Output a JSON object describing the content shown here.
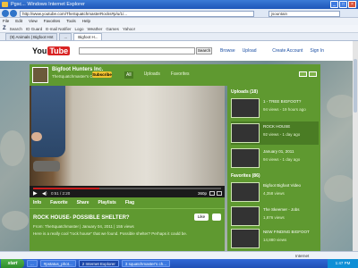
{
  "window": {
    "title": "Pgsc... Windows Internet Explorer",
    "url": "http://www.youtube.com/TheSquatchmasterRocks#p/u/1/...",
    "search_value": "jsountain",
    "buttons": [
      "minimize",
      "maximize",
      "close"
    ]
  },
  "menu": {
    "items": [
      "File",
      "Edit",
      "View",
      "Favorites",
      "Tools",
      "Help"
    ]
  },
  "toolbar": {
    "logo": "Z",
    "items": [
      "Search",
      "ID Guard",
      "E-mail Notifier",
      "Logo",
      "Weather",
      "Games",
      "Yahoo!"
    ]
  },
  "tabs": [
    {
      "label": "(9) Animals | Bigfoot Hnt",
      "active": false
    },
    {
      "label": "...",
      "active": false
    },
    {
      "label": "Bigfoot H...",
      "active": true
    }
  ],
  "youtube": {
    "logo_you": "You",
    "logo_tube": "Tube",
    "search_button": "Search",
    "links": [
      "Browse",
      "Upload"
    ],
    "right_links": [
      "Create Account",
      "Sign In"
    ]
  },
  "channel": {
    "name": "Bigfoot Hunters Inc.",
    "subtitle": "TheSquatchmaster's Channel",
    "subscribe": "Subscribe",
    "tabs": [
      "All",
      "Uploads",
      "Favorites"
    ]
  },
  "player": {
    "progress": 0.35,
    "time": "0:51 / 2:20",
    "quality": "360p"
  },
  "actions": [
    "Info",
    "Favorite",
    "Share",
    "Playlists",
    "Flag"
  ],
  "video": {
    "title": "ROCK HOUSE- POSSIBLE SHELTER?",
    "like": "Like",
    "meta": "From: TheSquatchmaster | January 04, 2011 | 155 views",
    "description": "Here is a really cool \"rock house\" that we found. Possible shelter? Perhaps it could be."
  },
  "sidebar": {
    "uploads_header": "Uploads (18)",
    "uploads": [
      {
        "title": "1 - TREE BIGFOOT?",
        "views": "94 views - 19 hours ago"
      },
      {
        "title": "ROCK HOUSE",
        "views": "92 views - 1 day ago"
      },
      {
        "title": "January 01, 2011",
        "views": "94 views - 1 day ago"
      }
    ],
    "favorites_header": "Favorites (86)",
    "favorites": [
      {
        "title": "Bigfoot Bigfoot Video",
        "views": "4,358 views"
      },
      {
        "title": "The Skeemer - Jobs",
        "views": "1,876 views"
      },
      {
        "title": "NEW FINDING BIGFOOT",
        "views": "14,880 views"
      }
    ]
  },
  "status": {
    "zone": "Internet"
  },
  "taskbar": {
    "start": "start",
    "tasks": [
      "...",
      "#pstatus_phot...",
      "2 Internet Explorer",
      "3 squatchmaster's ch..."
    ],
    "clock": "1:47 PM"
  }
}
